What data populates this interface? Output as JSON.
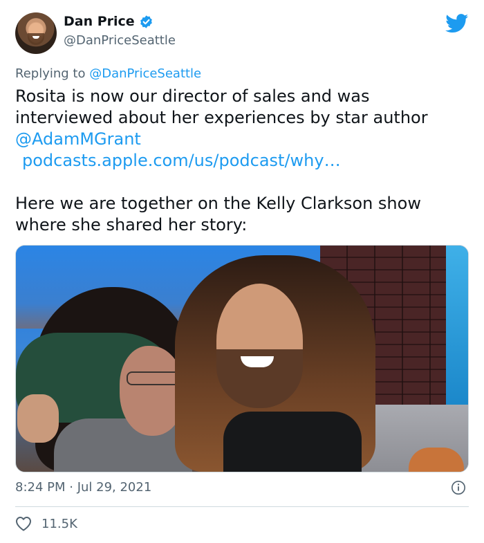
{
  "author": {
    "display_name": "Dan Price",
    "handle": "@DanPriceSeattle",
    "avatar_icon": "user-avatar",
    "verified_icon": "verified-badge-icon"
  },
  "reply": {
    "prefix": "Replying to ",
    "mention": "@DanPriceSeattle"
  },
  "body": {
    "line1": "Rosita is now our director of sales and was interviewed about her experiences by star author",
    "mention": "@AdamMGrant",
    "url": "podcasts.apple.com/us/podcast/why…",
    "paragraph2": "Here we are together on the Kelly Clarkson show where she shared her story:"
  },
  "meta": {
    "timestamp": "8:24 PM · Jul 29, 2021"
  },
  "actions": {
    "like_count": "11.5K"
  },
  "icons": {
    "brand": "twitter-bird-icon",
    "info": "info-icon",
    "like": "heart-icon"
  },
  "colors": {
    "link": "#1d9bf0",
    "secondary_text": "#536471",
    "primary_text": "#0f1419"
  }
}
